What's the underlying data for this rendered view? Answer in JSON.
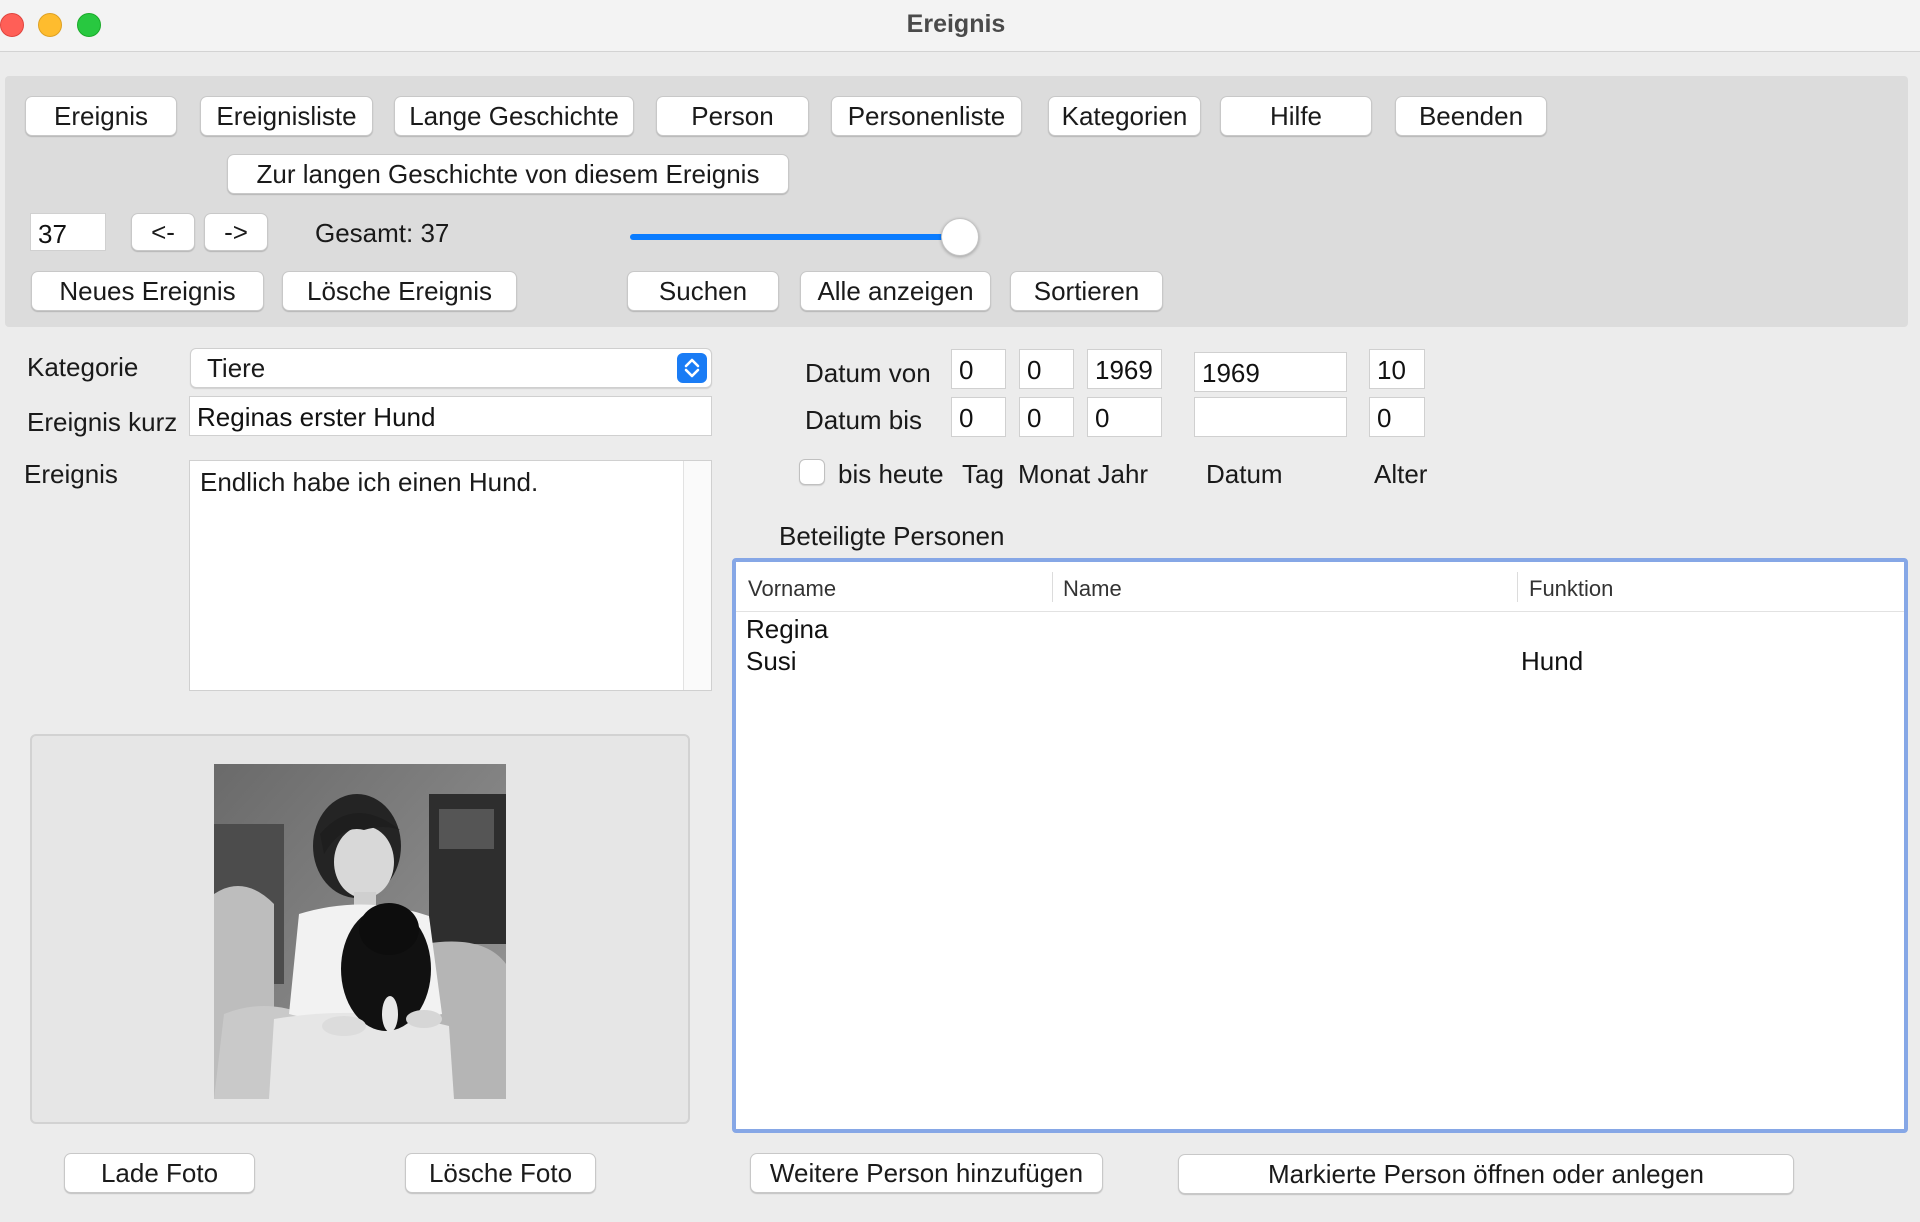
{
  "window": {
    "title": "Ereignis"
  },
  "toolbar": {
    "buttons": [
      "Ereignis",
      "Ereignisliste",
      "Lange Geschichte",
      "Person",
      "Personenliste",
      "Kategorien",
      "Hilfe",
      "Beenden"
    ],
    "long_story_button": "Zur langen Geschichte von diesem Ereignis",
    "record_number": "37",
    "prev_label": "<-",
    "next_label": "->",
    "total_label": "Gesamt: 37",
    "slider_fraction": 1.0,
    "new_event": "Neues Ereignis",
    "delete_event": "Lösche Ereignis",
    "search": "Suchen",
    "show_all": "Alle anzeigen",
    "sort": "Sortieren"
  },
  "form": {
    "category_label": "Kategorie",
    "category_value": "Tiere",
    "short_label": "Ereignis kurz",
    "short_value": "Reginas erster Hund",
    "event_label": "Ereignis",
    "event_text": "Endlich habe ich einen Hund."
  },
  "dates": {
    "from_label": "Datum von",
    "to_label": "Datum bis",
    "from_day": "0",
    "from_month": "0",
    "from_year": "1969",
    "from_date": "1969",
    "from_age": "10",
    "to_day": "0",
    "to_month": "0",
    "to_year": "0",
    "to_date": "",
    "to_age": "0",
    "until_today_label": "bis heute",
    "until_today_checked": false,
    "col_day": "Tag",
    "col_month_year": "Monat Jahr",
    "col_date": "Datum",
    "col_age": "Alter"
  },
  "persons": {
    "section_label": "Beteiligte Personen",
    "columns": [
      "Vorname",
      "Name",
      "Funktion"
    ],
    "rows": [
      {
        "vorname": "Regina",
        "name": "",
        "funktion": ""
      },
      {
        "vorname": "Susi",
        "name": "",
        "funktion": "Hund"
      }
    ],
    "add_button": "Weitere Person hinzufügen",
    "open_button": "Markierte Person öffnen oder anlegen"
  },
  "photo": {
    "load_button": "Lade Foto",
    "delete_button": "Lösche Foto"
  },
  "colors": {
    "accent": "#0a7cff",
    "table_focus": "#86a7e6"
  }
}
